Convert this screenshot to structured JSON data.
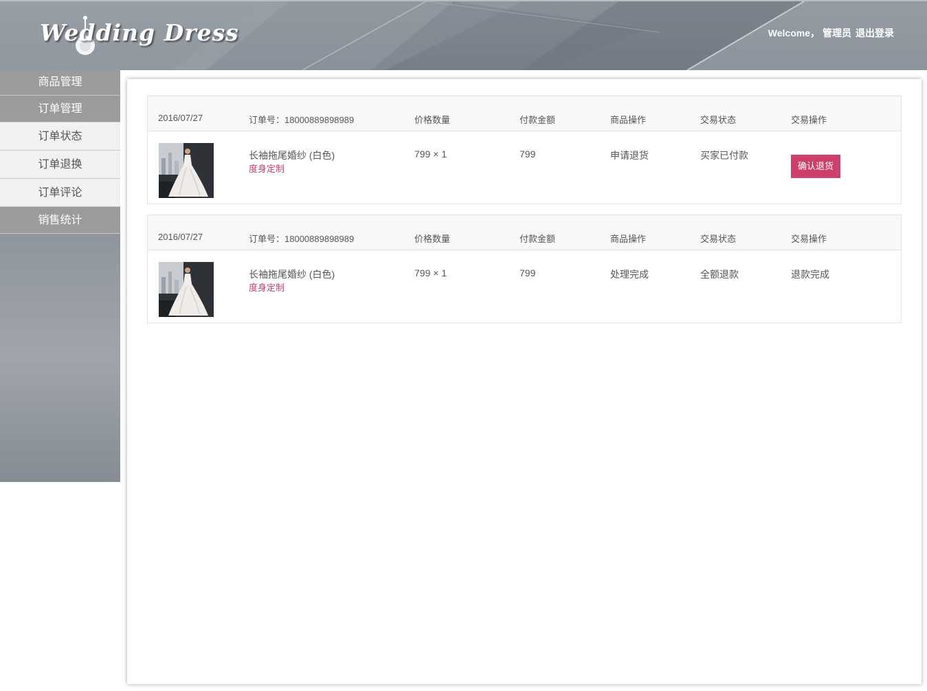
{
  "header": {
    "logo": "Wedding Dress",
    "welcome": "Welcome，",
    "user": "管理员",
    "logout": "退出登录"
  },
  "sidebar": {
    "items": [
      {
        "label": "商品管理"
      },
      {
        "label": "订单管理"
      },
      {
        "label": "订单状态"
      },
      {
        "label": "订单退换"
      },
      {
        "label": "订单评论"
      },
      {
        "label": "销售统计"
      }
    ]
  },
  "orders": [
    {
      "date": "2016/07/27",
      "order_no": "订单号：18000889898989",
      "col_price_qty": "价格数量",
      "col_paid": "付款金额",
      "col_goods_op": "商品操作",
      "col_status": "交易状态",
      "col_trade_op": "交易操作",
      "product_name": "长袖拖尾婚纱 (白色)",
      "product_tag": "度身定制",
      "price_qty": "799 × 1",
      "paid": "799",
      "goods_op": "申请退货",
      "status": "买家已付款",
      "trade_op": "确认退货"
    },
    {
      "date": "2016/07/27",
      "order_no": "订单号：18000889898989",
      "col_price_qty": "价格数量",
      "col_paid": "付款金额",
      "col_goods_op": "商品操作",
      "col_status": "交易状态",
      "col_trade_op": "交易操作",
      "product_name": "长袖拖尾婚纱 (白色)",
      "product_tag": "度身定制",
      "price_qty": "799 × 1",
      "paid": "799",
      "goods_op": "处理完成",
      "status": "全额退款",
      "trade_op": "退款完成"
    }
  ],
  "colors": {
    "accent": "#cf3f6b",
    "nav_main": "#9b9b9b",
    "nav_sub": "#f1f1f1"
  }
}
